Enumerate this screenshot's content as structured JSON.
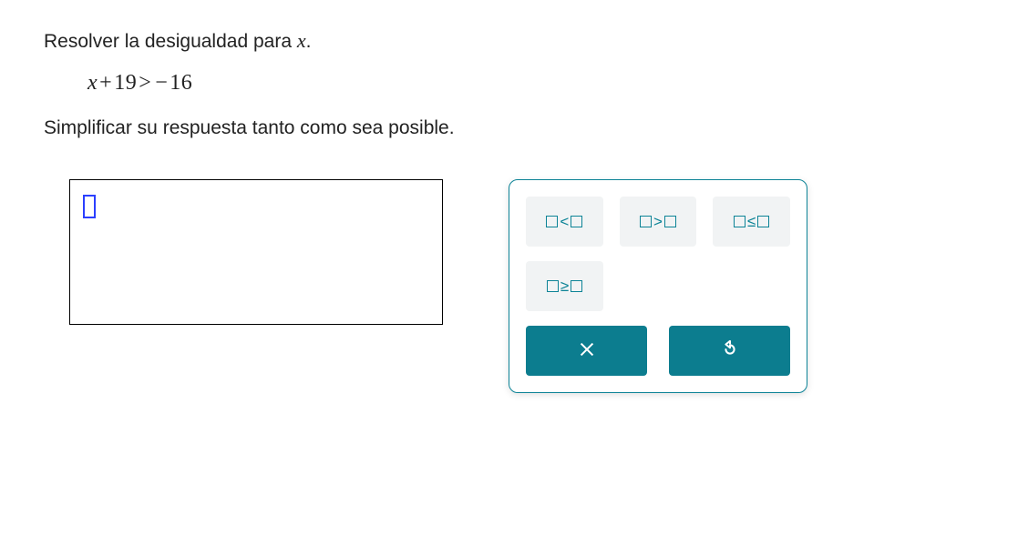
{
  "prompt": {
    "line1_before": "Resolver la desigualdad para ",
    "line1_var": "x",
    "line1_after": ".",
    "inequality": "x + 19 > − 16",
    "line2": "Simplificar su respuesta tanto como sea posible."
  },
  "answer": {
    "value": ""
  },
  "keypad": {
    "lt": "<",
    "gt": ">",
    "le": "≤",
    "ge": "≥",
    "clear": "clear",
    "undo": "undo"
  }
}
